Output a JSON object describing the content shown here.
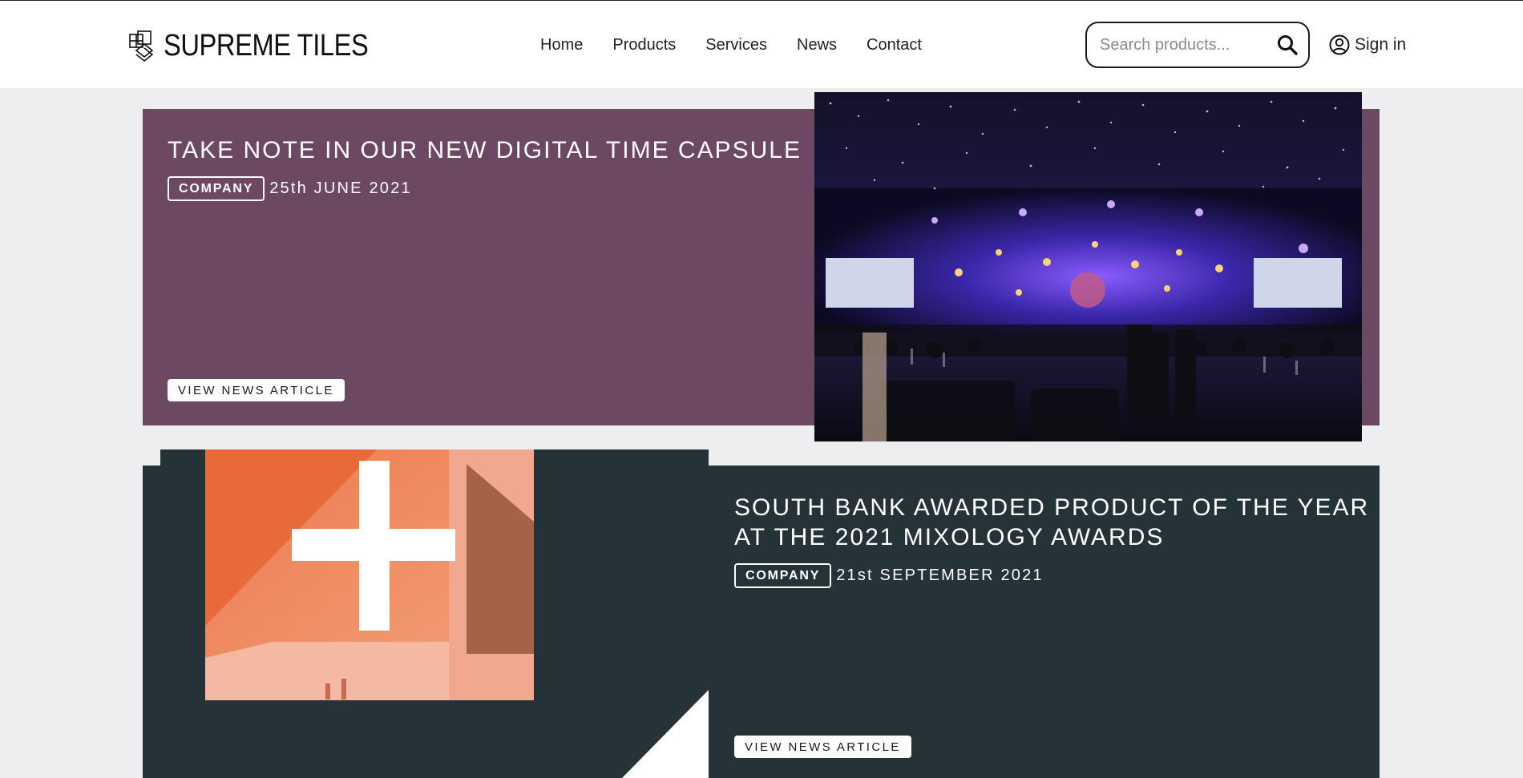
{
  "brand": {
    "name": "SUPREME TILES",
    "logo_icon": "stacked-tiles-icon"
  },
  "nav": {
    "items": [
      {
        "label": "Home"
      },
      {
        "label": "Products"
      },
      {
        "label": "Services"
      },
      {
        "label": "News"
      },
      {
        "label": "Contact"
      }
    ]
  },
  "search": {
    "placeholder": "Search products...",
    "value": "",
    "icon": "search-icon"
  },
  "account": {
    "signin_label": "Sign in",
    "icon": "user-circle-icon"
  },
  "articles": [
    {
      "title_lines": [
        "TAKE NOTE IN OUR NEW DIGITAL TIME CAPSULE"
      ],
      "tag": "COMPANY",
      "date": "25th JUNE 2021",
      "cta": "VIEW NEWS ARTICLE",
      "color": "#6d4863"
    },
    {
      "title_lines": [
        "SOUTH BANK AWARDED PRODUCT OF THE YEAR",
        "AT THE 2021 MIXOLOGY AWARDS"
      ],
      "tag": "COMPANY",
      "date": "21st SEPTEMBER 2021",
      "cta": "VIEW NEWS ARTICLE",
      "color": "#253339"
    }
  ]
}
